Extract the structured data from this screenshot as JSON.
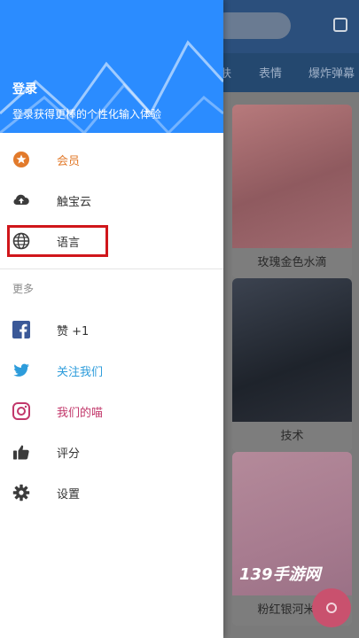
{
  "background": {
    "tabs": [
      "表情",
      "爆炸弹幕"
    ],
    "partial_tab": "肤",
    "cards": [
      {
        "title": "玫瑰金色水滴"
      },
      {
        "title": "技术"
      },
      {
        "title": "粉红银河米妮"
      }
    ],
    "watermark": "139手游网",
    "icons": {
      "store": "store-icon",
      "fab": "palette-icon"
    }
  },
  "drawer": {
    "header": {
      "title": "登录",
      "subtitle": "登录获得更棒的个性化输入体验",
      "color": "#2b8cff"
    },
    "items": [
      {
        "label": "会员",
        "icon": "star-badge-icon",
        "color": "#e27a2b"
      },
      {
        "label": "触宝云",
        "icon": "cloud-upload-icon",
        "color": "#333333"
      },
      {
        "label": "语言",
        "icon": "globe-icon",
        "color": "#333333",
        "highlighted": true
      }
    ],
    "more_label": "更多",
    "more_items": [
      {
        "label": "赞 +1",
        "icon": "facebook-icon",
        "color": "#333333"
      },
      {
        "label": "关注我们",
        "icon": "twitter-icon",
        "color": "#2d9cdb"
      },
      {
        "label": "我们的喵",
        "icon": "instagram-icon",
        "color": "#c2386b"
      },
      {
        "label": "评分",
        "icon": "thumbs-up-icon",
        "color": "#333333"
      },
      {
        "label": "设置",
        "icon": "gear-icon",
        "color": "#333333"
      }
    ],
    "highlight_color": "#d0161b"
  }
}
